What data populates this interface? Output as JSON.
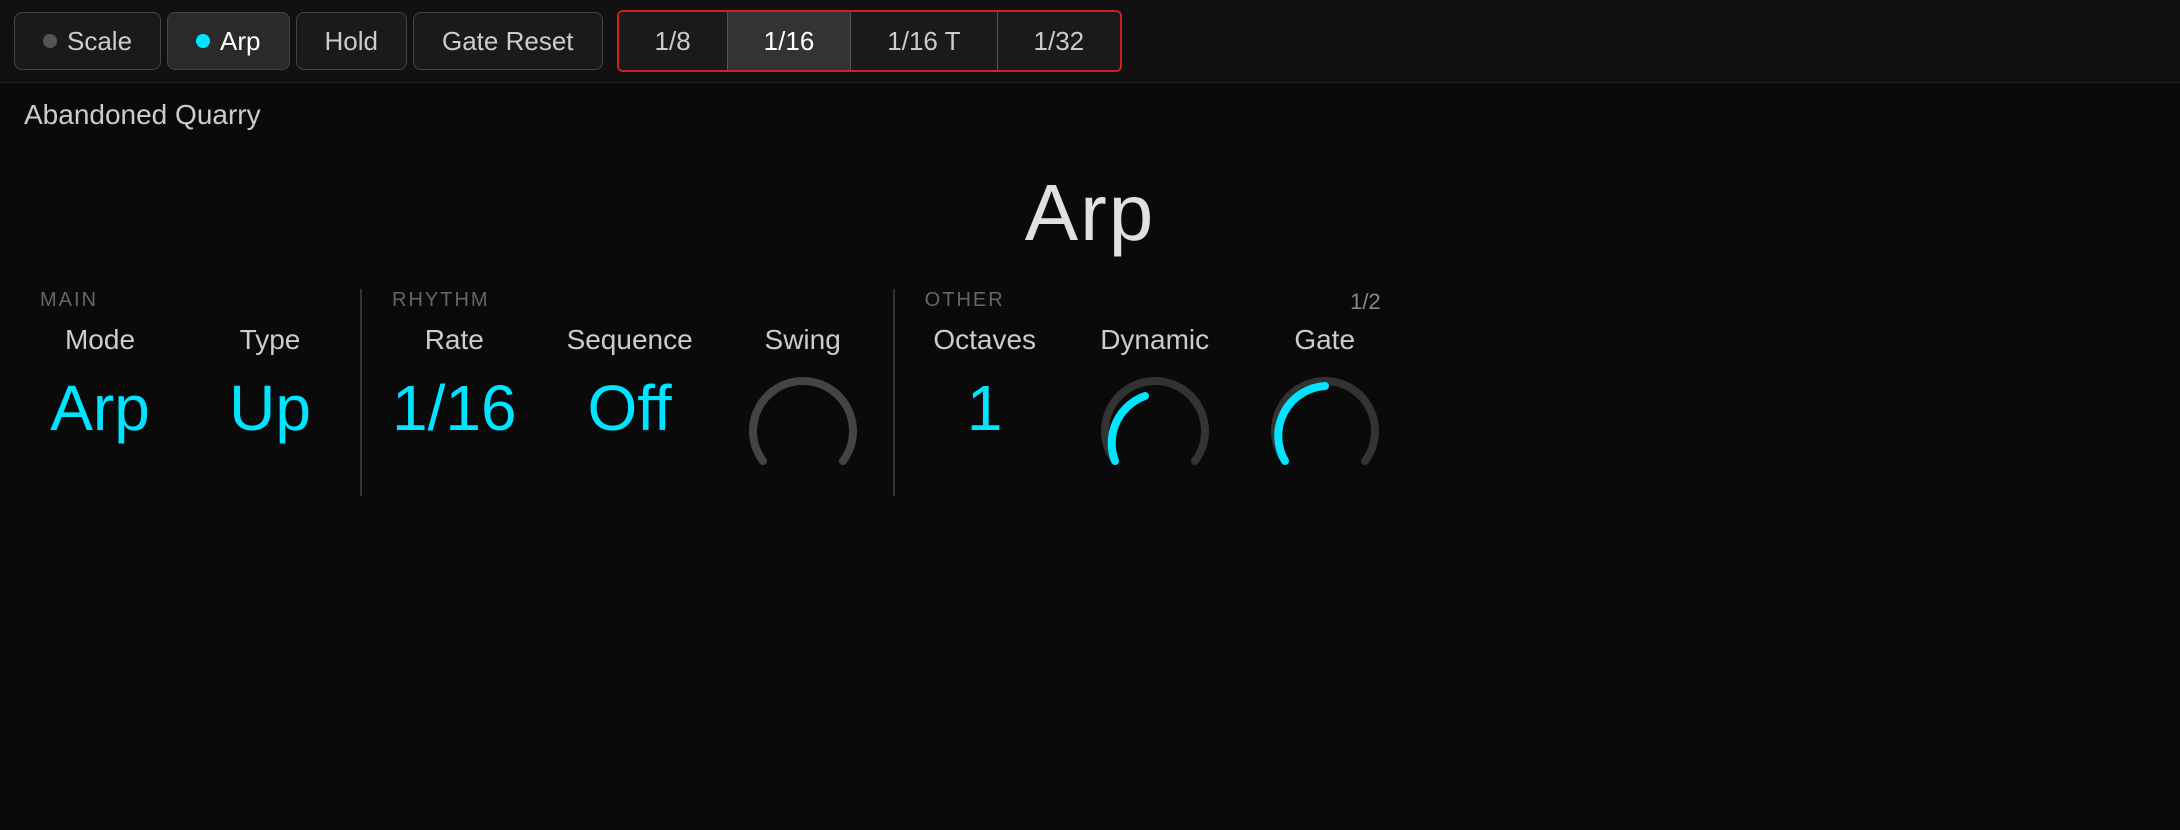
{
  "topBar": {
    "scaleLabel": "Scale",
    "arpLabel": "Arp",
    "holdLabel": "Hold",
    "gateResetLabel": "Gate Reset",
    "rates": [
      "1/8",
      "1/16",
      "1/16 T",
      "1/32"
    ],
    "selectedRate": "1/16"
  },
  "presetName": "Abandoned Quarry",
  "mainTitle": "Arp",
  "sections": {
    "main": {
      "label": "MAIN",
      "controls": [
        {
          "name": "Mode",
          "value": "Arp"
        },
        {
          "name": "Type",
          "value": "Up"
        }
      ]
    },
    "rhythm": {
      "label": "RHYTHM",
      "controls": [
        {
          "name": "Rate",
          "value": "1/16"
        },
        {
          "name": "Sequence",
          "value": "Off"
        },
        {
          "name": "Swing",
          "value": ""
        }
      ]
    },
    "other": {
      "label": "OTHER",
      "fraction": "1/2",
      "controls": [
        {
          "name": "Octaves",
          "value": "1"
        },
        {
          "name": "Dynamic",
          "value": ""
        },
        {
          "name": "Gate",
          "value": ""
        }
      ]
    }
  },
  "knobs": {
    "swing": {
      "angle": 0,
      "trackColor": "#444",
      "arcColor": "#555"
    },
    "dynamic": {
      "angle": -30,
      "trackColor": "#333",
      "arcColor": "#00e5ff"
    },
    "gate": {
      "angle": 30,
      "trackColor": "#333",
      "arcColor": "#00e5ff"
    }
  }
}
